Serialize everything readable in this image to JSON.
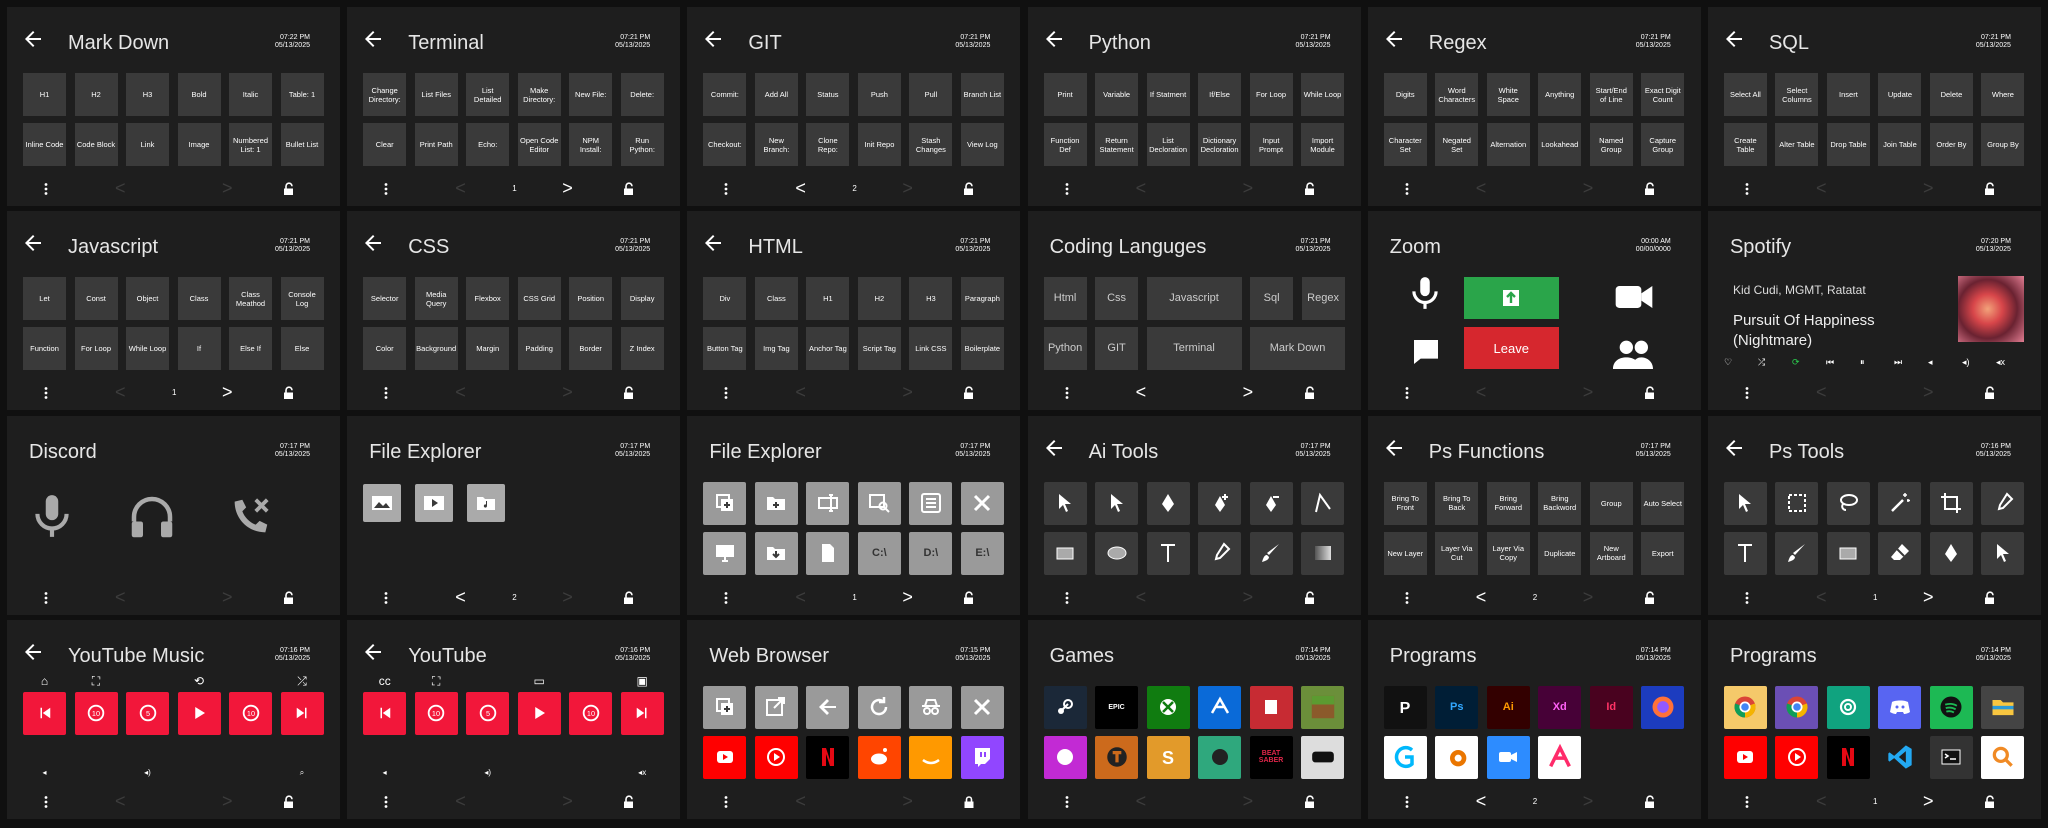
{
  "panels": [
    {
      "title": "Mark Down",
      "time": "07:22 PM",
      "date": "05/13/2025",
      "back": true,
      "buttons": [
        "H1",
        "H2",
        "H3",
        "Bold",
        "Italic",
        "Table: 1",
        "Inline Code",
        "Code Block",
        "Link",
        "Image",
        "Numbered List: 1",
        "Bullet List"
      ],
      "page": "",
      "left": false,
      "right": false
    },
    {
      "title": "Terminal",
      "time": "07:21 PM",
      "date": "05/13/2025",
      "back": true,
      "buttons": [
        "Change Directory:",
        "List Files",
        "List Detailed",
        "Make Directory:",
        "New File:",
        "Delete:",
        "Clear",
        "Print Path",
        "Echo:",
        "Open Code Editor",
        "NPM Install:",
        "Run Python:"
      ],
      "page": "1",
      "left": false,
      "right": true
    },
    {
      "title": "GIT",
      "time": "07:21 PM",
      "date": "05/13/2025",
      "back": true,
      "buttons": [
        "Commit:",
        "Add All",
        "Status",
        "Push",
        "Pull",
        "Branch List",
        "Checkout:",
        "New Branch:",
        "Clone Repo:",
        "Init Repo",
        "Stash Changes",
        "View Log"
      ],
      "page": "2",
      "left": true,
      "right": false
    },
    {
      "title": "Python",
      "time": "07:21 PM",
      "date": "05/13/2025",
      "back": true,
      "buttons": [
        "Print",
        "Variable",
        "If Statment",
        "If/Else",
        "For Loop",
        "While Loop",
        "Function Def",
        "Return Statement",
        "List Decloration",
        "Dictionary Decloration",
        "Input Prompt",
        "Import Module"
      ],
      "page": "",
      "left": false,
      "right": false
    },
    {
      "title": "Regex",
      "time": "07:21 PM",
      "date": "05/13/2025",
      "back": true,
      "buttons": [
        "Digits",
        "Word Characters",
        "White Space",
        "Anything",
        "Start/End of Line",
        "Exact Digit Count",
        "Character Set",
        "Negated Set",
        "Alternation",
        "Lookahead",
        "Named Group",
        "Capture Group"
      ],
      "page": "",
      "left": false,
      "right": false
    },
    {
      "title": "SQL",
      "time": "07:21 PM",
      "date": "05/13/2025",
      "back": true,
      "buttons": [
        "Select All",
        "Select Columns",
        "Insert",
        "Update",
        "Delete",
        "Where",
        "Create Table",
        "Alter Table",
        "Drop Table",
        "Join Table",
        "Order By",
        "Group By"
      ],
      "page": "",
      "left": false,
      "right": false
    },
    {
      "title": "Javascript",
      "time": "07:21 PM",
      "date": "05/13/2025",
      "back": true,
      "buttons": [
        "Let",
        "Const",
        "Object",
        "Class",
        "Class Meathod",
        "Console Log",
        "Function",
        "For Loop",
        "While Loop",
        "If",
        "Else If",
        "Else"
      ],
      "page": "1",
      "left": false,
      "right": true
    },
    {
      "title": "CSS",
      "time": "07:21 PM",
      "date": "05/13/2025",
      "back": true,
      "buttons": [
        "Selector",
        "Media Query",
        "Flexbox",
        "CSS Grid",
        "Position",
        "Display",
        "Color",
        "Background",
        "Margin",
        "Padding",
        "Border",
        "Z Index"
      ],
      "page": "",
      "left": false,
      "right": false
    },
    {
      "title": "HTML",
      "time": "07:21 PM",
      "date": "05/13/2025",
      "back": true,
      "buttons": [
        "Div",
        "Class",
        "H1",
        "H2",
        "H3",
        "Paragraph",
        "Button Tag",
        "Img Tag",
        "Anchor Tag",
        "Script Tag",
        "Link CSS",
        "Boilerplate"
      ],
      "page": "",
      "left": false,
      "right": false
    },
    {
      "title": "Coding Languges",
      "time": "07:21 PM",
      "date": "05/13/2025",
      "back": false,
      "lang": [
        [
          "Html",
          "Css",
          "Javascript",
          "Sql",
          "Regex"
        ],
        [
          "Python",
          "GIT",
          "Terminal",
          "Mark Down"
        ]
      ],
      "page": "",
      "left": true,
      "right": true
    },
    {
      "title": "Zoom",
      "time": "00:00 AM",
      "date": "00/00/0000",
      "back": false,
      "leave": "Leave"
    },
    {
      "title": "Spotify",
      "time": "07:20 PM",
      "date": "05/13/2025",
      "back": false,
      "artist": "Kid Cudi, MGMT, Ratatat",
      "song": "Pursuit Of Happiness (Nightmare)"
    },
    {
      "title": "Discord",
      "time": "07:17 PM",
      "date": "05/13/2025",
      "back": false
    },
    {
      "title": "File Explorer",
      "time": "07:17 PM",
      "date": "05/13/2025",
      "back": false,
      "page": "2",
      "left": true,
      "right": false
    },
    {
      "title": "File Explorer",
      "time": "07:17 PM",
      "date": "05/13/2025",
      "back": false,
      "page": "1",
      "left": false,
      "right": true,
      "drives": [
        "C:\\",
        "D:\\",
        "E:\\"
      ]
    },
    {
      "title": "Ai Tools",
      "time": "07:17 PM",
      "date": "05/13/2025",
      "back": true
    },
    {
      "title": "Ps Functions",
      "time": "07:17 PM",
      "date": "05/13/2025",
      "back": true,
      "buttons": [
        "Bring To Front",
        "Bring To Back",
        "Bring Forward",
        "Bring Backword",
        "Group",
        "Auto Select",
        "New Layer",
        "Layer Via Cut",
        "Layer Via Copy",
        "Duplicate",
        "New Artboard",
        "Export"
      ],
      "page": "2",
      "left": true,
      "right": false
    },
    {
      "title": "Ps Tools",
      "time": "07:16 PM",
      "date": "05/13/2025",
      "back": true,
      "page": "1",
      "left": false,
      "right": true
    },
    {
      "title": "YouTube Music",
      "time": "07:16 PM",
      "date": "05/13/2025",
      "back": true
    },
    {
      "title": "YouTube",
      "time": "07:16 PM",
      "date": "05/13/2025",
      "back": true
    },
    {
      "title": "Web Browser",
      "time": "07:15 PM",
      "date": "05/13/2025",
      "back": false
    },
    {
      "title": "Games",
      "time": "07:14 PM",
      "date": "05/13/2025",
      "back": false,
      "labels": [
        "EPIC",
        "BEAT SABER"
      ]
    },
    {
      "title": "Programs",
      "time": "07:14 PM",
      "date": "05/13/2025",
      "back": false,
      "page": "2",
      "left": true,
      "right": false,
      "labels": [
        "Ps",
        "Ai",
        "Xd",
        "Id"
      ]
    },
    {
      "title": "Programs",
      "time": "07:14 PM",
      "date": "05/13/2025",
      "back": false,
      "page": "1",
      "left": false,
      "right": true
    }
  ],
  "colors": {
    "panel": "#1e1e1e",
    "button": "#3a3a3a",
    "red": "#f2173a",
    "zoom_green": "#2aa54a",
    "zoom_red": "#d6272e"
  }
}
